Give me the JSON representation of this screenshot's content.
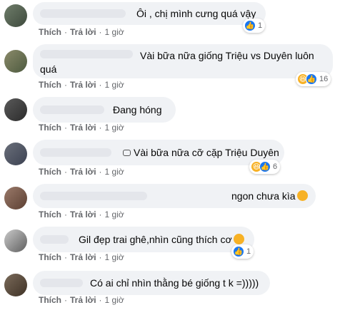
{
  "actions": {
    "like": "Thích",
    "reply": "Trả lời",
    "separator": "·"
  },
  "comments": [
    {
      "text": "Ôi , chị mình cưng quá vậy",
      "time": "1 giờ",
      "reaction_count": "1"
    },
    {
      "text": "Vài bữa nữa giống Triệu vs Duyên luôn",
      "text2": "quá",
      "time": "1 giờ",
      "reaction_count": "16"
    },
    {
      "text": "Đang hóng",
      "time": "1 giờ"
    },
    {
      "text": "Vài bữa nữa cỡ cặp Triệu Duyên",
      "time": "1 giờ",
      "reaction_count": "6"
    },
    {
      "text": "ngon chưa kìa",
      "time": "1 giờ"
    },
    {
      "text": "Gil đẹp trai ghê,nhìn cũng thích cơ",
      "time": "1 giờ",
      "reaction_count": "1"
    },
    {
      "text": "Có ai chỉ nhìn thằng bé giống t k =)))))",
      "time": "1 giờ"
    }
  ],
  "icons": {
    "like": "like-icon",
    "haha": "haha-icon",
    "emoji": "smiley-emoji-icon"
  }
}
